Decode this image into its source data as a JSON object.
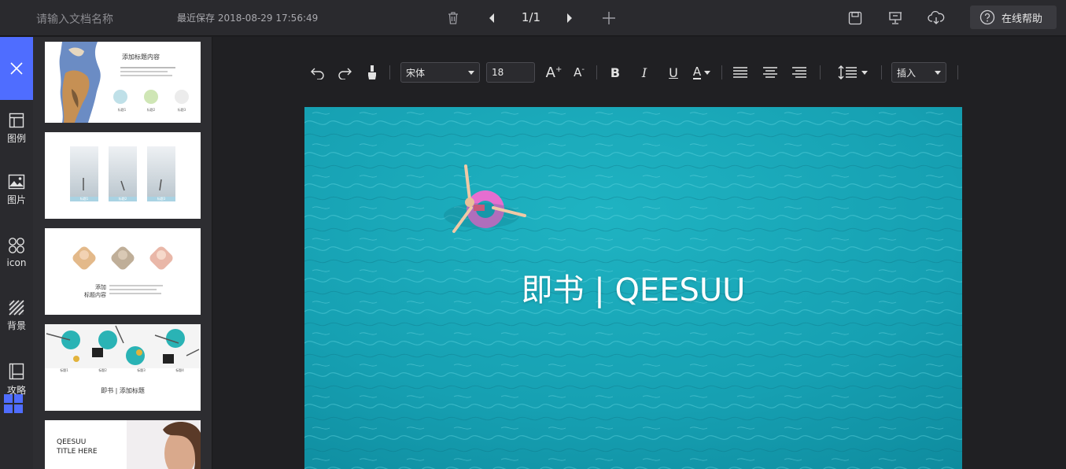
{
  "topbar": {
    "doc_name_placeholder": "请输入文档名称",
    "last_saved": "最近保存 2018-08-29 17:56:49",
    "page_counter": "1/1",
    "help_label": "在线帮助"
  },
  "rail": {
    "items": [
      {
        "label": "图例",
        "icon": "layout-icon"
      },
      {
        "label": "图片",
        "icon": "image-icon"
      },
      {
        "label": "icon",
        "icon": "icons-grid-icon"
      },
      {
        "label": "背景",
        "icon": "background-icon"
      },
      {
        "label": "攻略",
        "icon": "book-icon"
      }
    ]
  },
  "thumbnails": [
    {
      "title": "添加标题内容",
      "circle_labels": [
        "标题1",
        "标题2",
        "标题3"
      ]
    },
    {
      "captions": [
        "标题1",
        "标题2",
        "标题3"
      ]
    },
    {
      "title": "添加\n标题内容"
    },
    {
      "title": "即书 | 添加标题",
      "captions": [
        "标题1",
        "标题2",
        "标题3",
        "标题4"
      ]
    },
    {
      "line1": "QEESUU",
      "line2": "TITLE HERE"
    }
  ],
  "toolbar": {
    "font_family": "宋体",
    "font_size": "18",
    "insert_label": "插入",
    "bold": "B",
    "italic": "I",
    "underline": "U",
    "font_color": "A",
    "grow": "A",
    "shrink": "A"
  },
  "slide": {
    "title": "即书 | QEESUU"
  },
  "colors": {
    "accent": "#4f6dff",
    "water": "#1aa0b0"
  }
}
